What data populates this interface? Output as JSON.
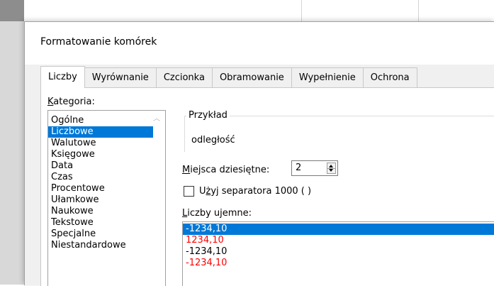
{
  "dialog": {
    "title": "Formatowanie komórek",
    "tabs": [
      {
        "label": "Liczby",
        "active": true
      },
      {
        "label": "Wyrównanie",
        "active": false
      },
      {
        "label": "Czcionka",
        "active": false
      },
      {
        "label": "Obramowanie",
        "active": false
      },
      {
        "label": "Wypełnienie",
        "active": false
      },
      {
        "label": "Ochrona",
        "active": false
      }
    ]
  },
  "category": {
    "label_first": "K",
    "label_rest": "ategoria:",
    "items": [
      "Ogólne",
      "Liczbowe",
      "Walutowe",
      "Księgowe",
      "Data",
      "Czas",
      "Procentowe",
      "Ułamkowe",
      "Naukowe",
      "Tekstowe",
      "Specjalne",
      "Niestandardowe"
    ],
    "selected_index": 1
  },
  "example": {
    "label": "Przykład",
    "value": "odległość"
  },
  "decimal": {
    "label_first": "M",
    "label_rest": "iejsca dziesiętne:",
    "value": "2"
  },
  "separator": {
    "label_pre": "U",
    "label_ul": "ż",
    "label_rest": "yj separatora 1000 ( )",
    "checked": false
  },
  "negative": {
    "label_first": "L",
    "label_rest": "iczby ujemne:",
    "items": [
      {
        "text": "-1234,10",
        "color": "#ffffff",
        "selected": true
      },
      {
        "text": "1234,10",
        "color": "#ff0000",
        "selected": false
      },
      {
        "text": "-1234,10",
        "color": "#000000",
        "selected": false
      },
      {
        "text": "-1234,10",
        "color": "#ff0000",
        "selected": false
      }
    ]
  },
  "colors": {
    "selection": "#0078d7",
    "negative_red": "#ff0000",
    "dialog_bg": "#f0f0f0"
  }
}
